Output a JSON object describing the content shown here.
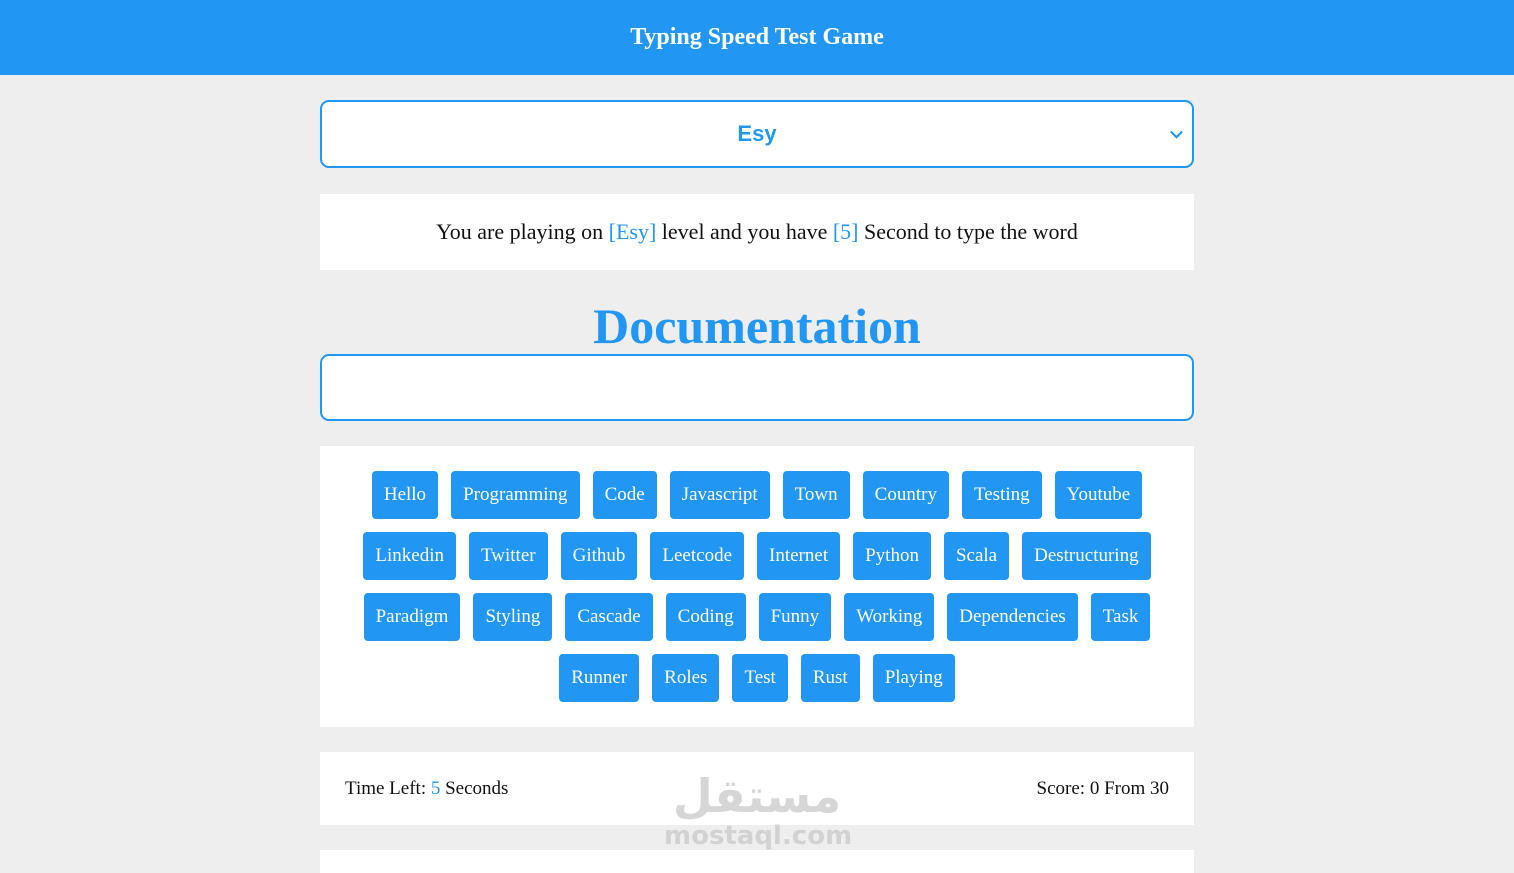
{
  "header": {
    "title": "Typing Speed Test Game"
  },
  "level_select": {
    "selected": "Esy"
  },
  "message": {
    "prefix": "You are playing on",
    "level": "[Esy]",
    "middle": "level and you have",
    "seconds": "[5]",
    "suffix": "Second to type the word"
  },
  "current_word": "Documentation",
  "input": {
    "value": "",
    "placeholder": ""
  },
  "upcoming_words": [
    "Hello",
    "Programming",
    "Code",
    "Javascript",
    "Town",
    "Country",
    "Testing",
    "Youtube",
    "Linkedin",
    "Twitter",
    "Github",
    "Leetcode",
    "Internet",
    "Python",
    "Scala",
    "Destructuring",
    "Paradigm",
    "Styling",
    "Cascade",
    "Coding",
    "Funny",
    "Working",
    "Dependencies",
    "Task",
    "Runner",
    "Roles",
    "Test",
    "Rust",
    "Playing"
  ],
  "control": {
    "time_label": "Time Left:",
    "time_value": "5",
    "time_unit": "Seconds",
    "score_label": "Score:",
    "score_value": "0",
    "score_from": "From",
    "score_total": "30"
  },
  "watermark": {
    "arabic": "مستقل",
    "latin": "mostaql.com"
  },
  "colors": {
    "accent": "#2196f3",
    "background": "#eeeeee",
    "panel": "#ffffff"
  }
}
